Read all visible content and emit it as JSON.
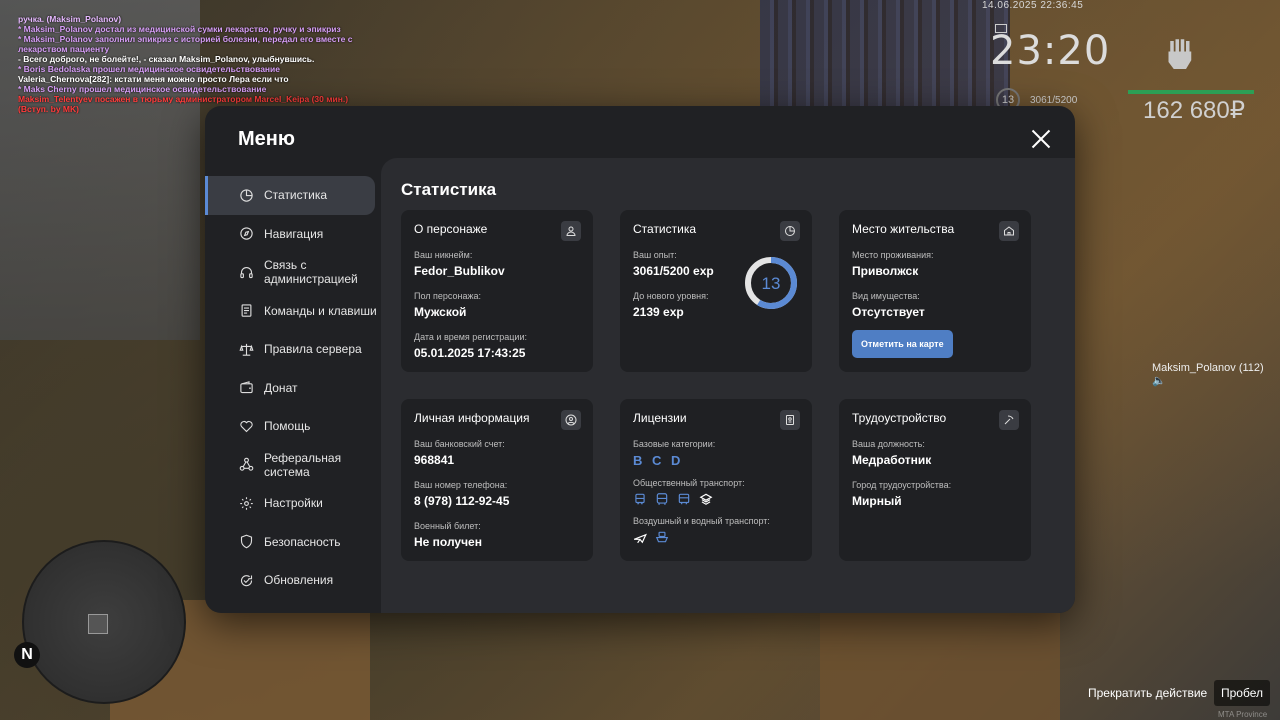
{
  "chat": [
    {
      "text": "ручка. (Maksim_Polanov)",
      "color": "#e6b8ff"
    },
    {
      "text": "* Maksim_Polanov достал из медицинской сумки лекарство, ручку и эпикриз",
      "color": "#d59cf5"
    },
    {
      "text": "* Maksim_Polanov заполнил эпикриз с историей болезни, передал его вместе с",
      "color": "#d59cf5"
    },
    {
      "text": "лекарством пациенту",
      "color": "#d59cf5"
    },
    {
      "text": "- Всего доброго, не болейте!, - сказал Maksim_Polanov, улыбнувшись.",
      "color": "#ffffff"
    },
    {
      "text": "* Boris Bedolaska прошел медицинское освидетельствование",
      "color": "#d59cf5"
    },
    {
      "text": "Valeria_Chernova[282]: кстати меня можно просто Лера если что",
      "color": "#ffffff"
    },
    {
      "text": "* Maks Cherny прошел медицинское освидетельствование",
      "color": "#d59cf5"
    },
    {
      "text": "Maksim_Telentyev посажен в тюрьму администратором Marcel_Keipa (30 мин.)",
      "color": "#ff3b3b"
    },
    {
      "text": "(Вступ. by MK)",
      "color": "#ff3b3b"
    }
  ],
  "hud": {
    "date": "14.06.2025 22:36:45",
    "time": "23:20",
    "level": "13",
    "exp": "3061/5200",
    "money": "162 680₽"
  },
  "nametag": "Maksim_Polanov (112)",
  "bottom": {
    "action": "Прекратить действие",
    "key": "Пробел",
    "watermark": "MTA Province"
  },
  "menu": {
    "title": "Меню",
    "items": [
      {
        "label": "Статистика",
        "icon": "pie-chart-icon"
      },
      {
        "label": "Навигация",
        "icon": "compass-icon"
      },
      {
        "label": "Связь с администрацией",
        "icon": "headset-icon"
      },
      {
        "label": "Команды и клавиши",
        "icon": "document-icon"
      },
      {
        "label": "Правила сервера",
        "icon": "scales-icon"
      },
      {
        "label": "Донат",
        "icon": "wallet-icon"
      },
      {
        "label": "Помощь",
        "icon": "heart-handshake-icon"
      },
      {
        "label": "Реферальная система",
        "icon": "network-icon"
      },
      {
        "label": "Настройки",
        "icon": "gear-icon"
      },
      {
        "label": "Безопасность",
        "icon": "shield-icon"
      },
      {
        "label": "Обновления",
        "icon": "refresh-check-icon"
      }
    ]
  },
  "content": {
    "title": "Статистика",
    "character": {
      "title": "О персонаже",
      "nick_label": "Ваш никнейм:",
      "nick": "Fedor_Bublikov",
      "gender_label": "Пол персонажа:",
      "gender": "Мужской",
      "reg_label": "Дата и время регистрации:",
      "reg": "05.01.2025 17:43:25"
    },
    "stats": {
      "title": "Статистика",
      "exp_label": "Ваш опыт:",
      "exp": "3061/5200 exp",
      "next_label": "До нового уровня:",
      "next": "2139 exp",
      "level": "13",
      "progress": 0.589
    },
    "residence": {
      "title": "Место жительства",
      "place_label": "Место проживания:",
      "place": "Приволжск",
      "property_label": "Вид имущества:",
      "property": "Отсутствует",
      "button": "Отметить на карте"
    },
    "personal": {
      "title": "Личная информация",
      "bank_label": "Ваш банковский счет:",
      "bank": "968841",
      "phone_label": "Ваш номер телефона:",
      "phone": "8 (978) 112-92-45",
      "military_label": "Военный билет:",
      "military": "Не получен"
    },
    "licenses": {
      "title": "Лицензии",
      "base_label": "Базовые категории:",
      "base": "B C D",
      "public_label": "Общественный транспорт:",
      "air_label": "Воздушный и водный транспорт:"
    },
    "employment": {
      "title": "Трудоустройство",
      "position_label": "Ваша должность:",
      "position": "Медработник",
      "city_label": "Город трудоустройства:",
      "city": "Мирный"
    }
  },
  "colors": {
    "accent": "#5b8ad4",
    "panel": "#202124",
    "content": "#2b2c30",
    "card": "#1f2023"
  }
}
